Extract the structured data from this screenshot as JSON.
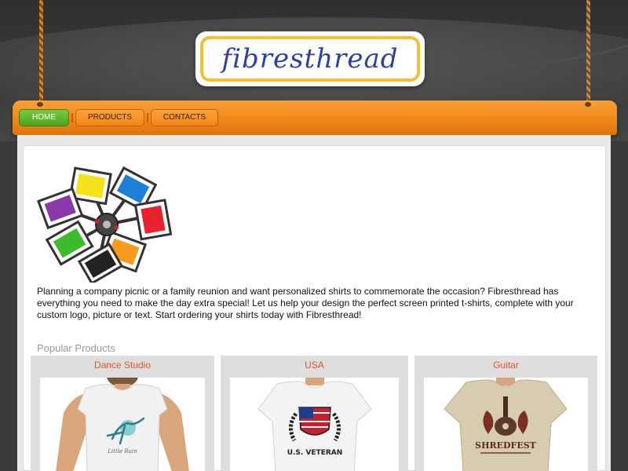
{
  "site": {
    "logo": "fibresthread"
  },
  "nav": {
    "items": [
      {
        "label": "HOME",
        "active": true
      },
      {
        "label": "PRODUCTS",
        "active": false
      },
      {
        "label": "CONTACTS",
        "active": false
      }
    ]
  },
  "main": {
    "intro": "Planning a company picnic or a family reunion and want personalized shirts to commemorate the occasion? Fibresthread has everything you need to make the day extra special! Let us help your design the perfect screen printed t-shirts, complete with your custom logo, picture or text. Start ordering your shirts today with Fibresthread!",
    "popular_title": "Popular Products",
    "products": [
      {
        "name": "Dance Studio",
        "print": "Little Rain"
      },
      {
        "name": "USA",
        "print": "U.S. VETERAN"
      },
      {
        "name": "Guitar",
        "print": "SHREDFEST"
      }
    ]
  },
  "colors": {
    "accent_orange": "#f08a1c",
    "active_green": "#4ea31c",
    "logo_border": "#f2c12e",
    "logo_text": "#2f3fa8",
    "product_title": "#e8542a"
  },
  "icons": [
    "screen-printing-press-icon"
  ]
}
